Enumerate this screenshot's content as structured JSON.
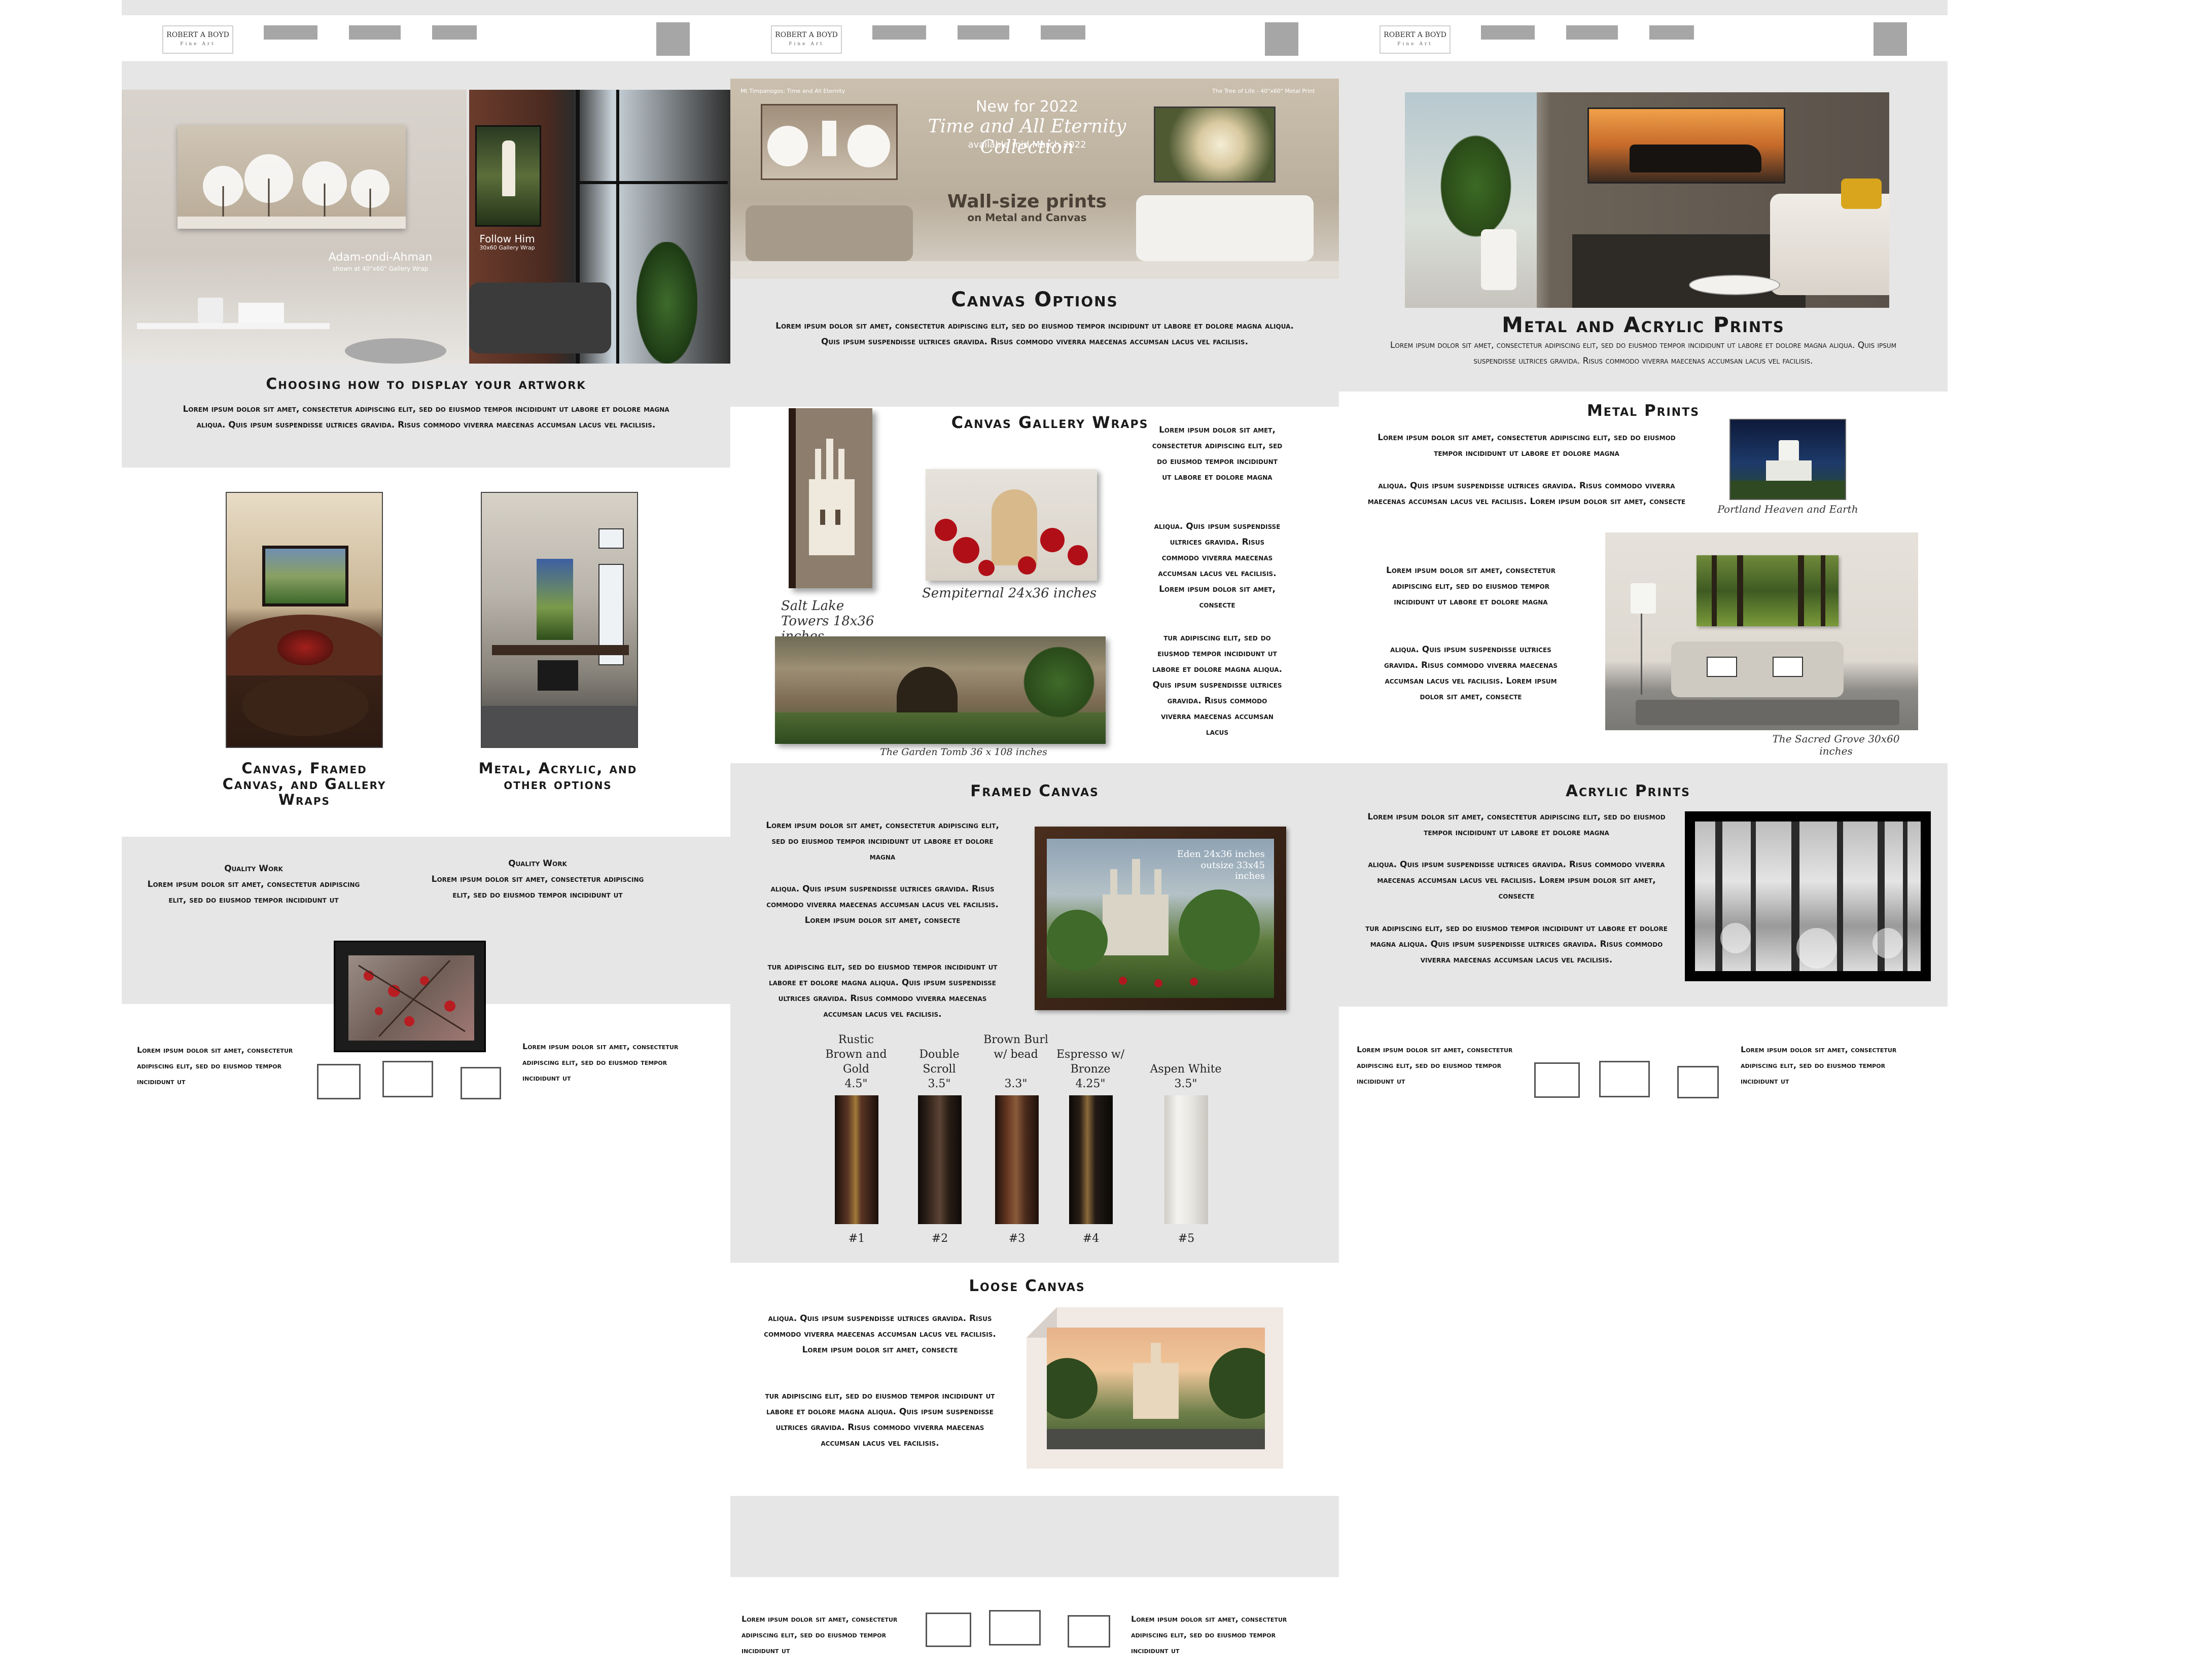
{
  "brand": {
    "line1": "ROBERT A BOYD",
    "line2": "Fine Art"
  },
  "col1": {
    "hero_caption1_title": "Adam-ondi-Ahman",
    "hero_caption1_sub": "shown at 40\"x60\" Gallery Wrap",
    "hero_caption2_title": "Follow Him",
    "hero_caption2_sub": "30x60 Gallery Wrap",
    "section_title": "Choosing how to display your artwork",
    "section_text": "Lorem ipsum dolor sit amet, consectetur adipiscing elit, sed do eiusmod tempor incididunt ut labore et dolore magna aliqua. Quis ipsum suspendisse ultrices gravida. Risus commodo viverra maecenas accumsan lacus vel facilisis.",
    "option1_label": "Canvas, Framed Canvas, and Gallery Wraps",
    "option2_label": "Metal, Acrylic, and other options",
    "quality1_title": "Quality Work",
    "quality1_text": "Lorem ipsum dolor sit amet, consectetur adipiscing elit, sed do eiusmod tempor incididunt ut",
    "quality2_title": "Quality Work",
    "quality2_text": "Lorem ipsum dolor sit amet, consectetur adipiscing elit, sed do eiusmod tempor incididunt ut",
    "footer_left": "Lorem ipsum dolor sit amet, consectetur adipiscing elit, sed do eiusmod tempor incididunt ut",
    "footer_right": "Lorem ipsum dolor sit amet, consectetur adipiscing elit, sed do eiusmod tempor incididunt ut"
  },
  "col2": {
    "banner_small_left": "Mt Timpanogos: Time and All Eternity",
    "banner_small_right": "The Tree of Life - 40\"x60\" Metal Print",
    "banner_new": "New for 2022",
    "banner_collection": "Time and All Eternity Collection",
    "banner_available": "available mid March 2022",
    "banner_wall": "Wall-size prints",
    "banner_metal": "on Metal and Canvas",
    "section_title": "Canvas Options",
    "section_text": "Lorem ipsum dolor sit amet, consectetur adipiscing elit, sed do eiusmod tempor incididunt ut labore et dolore magna aliqua. Quis ipsum suspendisse ultrices gravida. Risus commodo viverra maecenas accumsan lacus vel facilisis.",
    "gallery_title": "Canvas Gallery Wraps",
    "gallery_caption1": "Salt Lake Towers 18x36 inches",
    "gallery_caption2": "Sempiternal 24x36 inches",
    "gallery_caption3": "The Garden Tomb 36 x 108 inches",
    "gallery_text1": "Lorem ipsum dolor sit amet, consectetur adipiscing elit, sed do eiusmod tempor incididunt ut labore et dolore magna",
    "gallery_text2": "aliqua. Quis ipsum suspendisse ultrices gravida. Risus commodo viverra maecenas accumsan lacus vel facilisis. Lorem ipsum dolor sit amet, consecte",
    "gallery_text3": "tur adipiscing elit, sed do eiusmod tempor incididunt ut labore et dolore magna aliqua. Quis ipsum suspendisse ultrices gravida. Risus commodo viverra maecenas accumsan lacus",
    "framed_title": "Framed Canvas",
    "framed_text1": "Lorem ipsum dolor sit amet, consectetur adipiscing elit, sed do eiusmod tempor incididunt ut labore et dolore magna",
    "framed_text2": "aliqua. Quis ipsum suspendisse ultrices gravida. Risus commodo viverra maecenas accumsan lacus vel facilisis. Lorem ipsum dolor sit amet, consecte",
    "framed_text3": "tur adipiscing elit, sed do eiusmod tempor incididunt ut labore et dolore magna aliqua. Quis ipsum suspendisse ultrices gravida. Risus commodo viverra maecenas accumsan lacus vel facilisis.",
    "framed_caption1": "Eden 24x36 inches",
    "framed_caption2": "outsize 33x45 inches",
    "mouldings": [
      {
        "name": "Rustic Brown and Gold",
        "size": "4.5\"",
        "num": "#1",
        "color": "#3a2418"
      },
      {
        "name": "Double Scroll",
        "size": "3.5\"",
        "num": "#2",
        "color": "#2a1e16"
      },
      {
        "name": "Brown Burl w/ bead",
        "size": "3.3\"",
        "num": "#3",
        "color": "#4a2a1c"
      },
      {
        "name": "Espresso w/ Bronze",
        "size": "4.25\"",
        "num": "#4",
        "color": "#231a14"
      },
      {
        "name": "Aspen White",
        "size": "3.5\"",
        "num": "#5",
        "color": "#e9e7e2"
      }
    ],
    "loose_title": "Loose Canvas",
    "loose_text1": "aliqua. Quis ipsum suspendisse ultrices gravida. Risus commodo viverra maecenas accumsan lacus vel facilisis. Lorem ipsum dolor sit amet, consecte",
    "loose_text2": "tur adipiscing elit, sed do eiusmod tempor incididunt ut labore et dolore magna aliqua. Quis ipsum suspendisse ultrices gravida. Risus commodo viverra maecenas accumsan lacus vel facilisis.",
    "footer_left": "Lorem ipsum dolor sit amet, consectetur adipiscing elit, sed do eiusmod tempor incididunt ut",
    "footer_right": "Lorem ipsum dolor sit amet, consectetur adipiscing elit, sed do eiusmod tempor incididunt ut"
  },
  "col3": {
    "section_title": "Metal and Acrylic Prints",
    "section_text": "Lorem ipsum dolor sit amet, consectetur adipiscing elit, sed do eiusmod tempor incididunt ut labore et dolore magna aliqua. Quis ipsum suspendisse ultrices gravida. Risus commodo viverra maecenas accumsan lacus vel facilisis.",
    "metal_title": "Metal Prints",
    "metal_text1": "Lorem ipsum dolor sit amet, consectetur adipiscing elit, sed do eiusmod tempor incididunt ut labore et dolore magna",
    "metal_text2": "aliqua. Quis ipsum suspendisse ultrices gravida. Risus commodo viverra maecenas accumsan lacus vel facilisis. Lorem ipsum dolor sit amet, consecte",
    "metal_text3": "Lorem ipsum dolor sit amet, consectetur adipiscing elit, sed do eiusmod tempor incididunt ut labore et dolore magna",
    "metal_text4": "aliqua. Quis ipsum suspendisse ultrices gravida. Risus commodo viverra maecenas accumsan lacus vel facilisis. Lorem ipsum dolor sit amet, consecte",
    "metal_caption1": "Portland Heaven and Earth",
    "metal_caption2": "The Sacred Grove 30x60 inches",
    "acrylic_title": "Acrylic Prints",
    "acrylic_text1": "Lorem ipsum dolor sit amet, consectetur adipiscing elit, sed do eiusmod tempor incididunt ut labore et dolore magna",
    "acrylic_text2": "aliqua. Quis ipsum suspendisse ultrices gravida. Risus commodo viverra maecenas accumsan lacus vel facilisis. Lorem ipsum dolor sit amet, consecte",
    "acrylic_text3": "tur adipiscing elit, sed do eiusmod tempor incididunt ut labore et dolore magna aliqua. Quis ipsum suspendisse ultrices gravida. Risus commodo viverra maecenas accumsan lacus vel facilisis.",
    "footer_left": "Lorem ipsum dolor sit amet, consectetur adipiscing elit, sed do eiusmod tempor incididunt ut",
    "footer_right": "Lorem ipsum dolor sit amet, consectetur adipiscing elit, sed do eiusmod tempor incididunt ut"
  },
  "colors": {
    "panel_gray": "#e6e6e6",
    "nav_block": "#a6a6a6",
    "text": "#1a1a1a"
  }
}
